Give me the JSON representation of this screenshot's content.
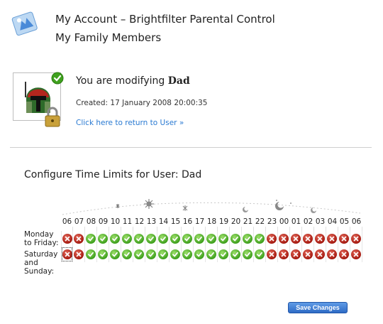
{
  "header": {
    "title": "My Account – Brightfilter Parental Control",
    "subtitle": "My Family Members",
    "logo_icon": "family-logo-icon"
  },
  "user": {
    "modifying_prefix": "You are modifying",
    "name": "Dad",
    "created": "Created: 17 January 2008 20:00:35",
    "return_link": "Click here to return to User »",
    "avatar_icon": "helmet-avatar-icon",
    "status_icon": "check-badge-icon",
    "lock_icon": "padlock-icon"
  },
  "time_limits": {
    "title": "Configure Time Limits for User: Dad",
    "hours": [
      "06",
      "07",
      "08",
      "09",
      "10",
      "11",
      "12",
      "13",
      "14",
      "15",
      "16",
      "17",
      "18",
      "19",
      "20",
      "21",
      "22",
      "23",
      "00",
      "01",
      "02",
      "03",
      "04",
      "05",
      "06"
    ],
    "rows": [
      {
        "label": "Monday to Friday:",
        "allowed": [
          false,
          false,
          true,
          true,
          true,
          true,
          true,
          true,
          true,
          true,
          true,
          true,
          true,
          true,
          true,
          true,
          true,
          false,
          false,
          false,
          false,
          false,
          false,
          false,
          false
        ]
      },
      {
        "label": "Saturday and Sunday:",
        "allowed": [
          false,
          false,
          true,
          true,
          true,
          true,
          true,
          true,
          true,
          true,
          true,
          true,
          true,
          true,
          true,
          true,
          true,
          false,
          false,
          false,
          false,
          false,
          false,
          false,
          false
        ]
      }
    ],
    "colors": {
      "allowed": "#3d9f1c",
      "blocked": "#a4180f"
    }
  },
  "actions": {
    "save_label": "Save Changes"
  }
}
